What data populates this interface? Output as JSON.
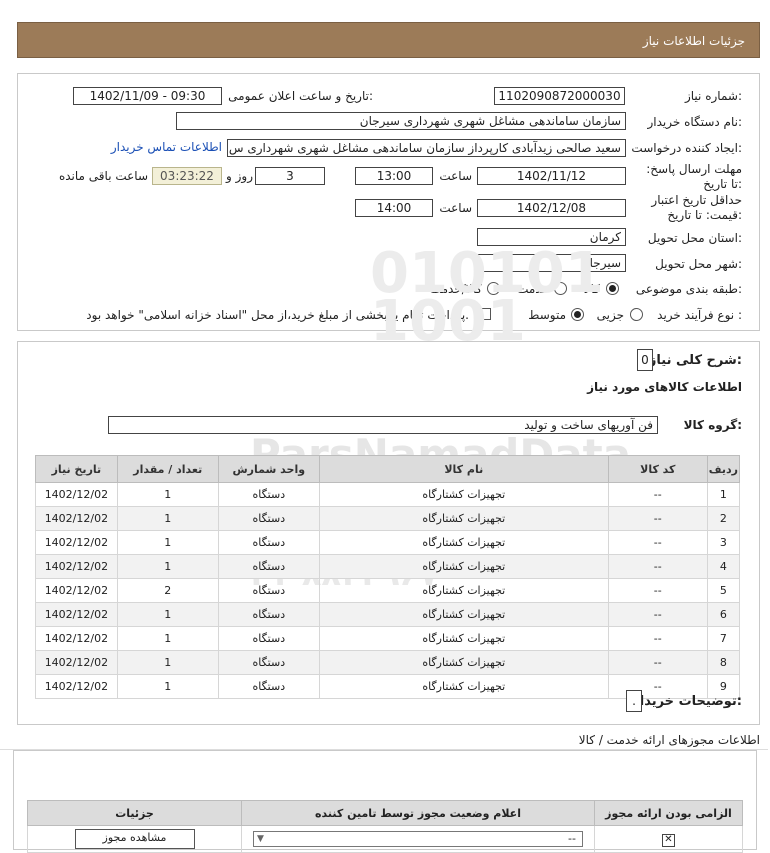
{
  "header": {
    "title": "جزئیات اطلاعات نیاز"
  },
  "form": {
    "need_number_label": "شماره نیاز:",
    "need_number": "1102090872000030",
    "announce_label": "تاریخ و ساعت اعلان عمومی:",
    "announce_value": "1402/11/09 - 09:30",
    "buyer_org_label": "نام دستگاه خریدار:",
    "buyer_org": "سازمان ساماندهی مشاغل شهری شهرداری سیرجان",
    "creator_label": "ایجاد کننده درخواست:",
    "creator": "سعید صالحی زیدآبادی کارپرداز سازمان ساماندهی مشاغل شهری شهرداری س",
    "contact_link": "اطلاعات تماس خریدار",
    "deadline_label": "مهلت ارسال پاسخ: تا تاریخ:",
    "deadline_date": "1402/11/12",
    "time_label": "ساعت",
    "deadline_time": "13:00",
    "days": "3",
    "days_label": "روز و",
    "remaining": "03:23:22",
    "remaining_label": "ساعت باقی مانده",
    "validity_label": "حداقل تاریخ اعتبار قیمت: تا تاریخ:",
    "validity_date": "1402/12/08",
    "validity_time": "14:00",
    "province_label": "استان محل تحویل:",
    "province": "کرمان",
    "city_label": "شهر محل تحویل:",
    "city": "سیرجان",
    "category_label": "طبقه بندی موضوعی:",
    "category_options": [
      "کالا",
      "خدمت",
      "کالا/خدمت"
    ],
    "category_selected": "کالا",
    "process_label": "نوع فرآیند خرید :",
    "process_options": [
      "جزیی",
      "متوسط"
    ],
    "process_selected": "متوسط",
    "payment_text": "پرداخت تمام یا بخشی از مبلغ خرید،از محل \"اسناد خزانه اسلامی\" خواهد بود."
  },
  "description": {
    "summary_label": "شرح کلی نیاز:",
    "summary_value": "0",
    "goods_title": "اطلاعات کالاهای مورد نیاز",
    "group_label": "گروه کالا:",
    "group_value": "فن آوریهای ساخت و تولید"
  },
  "items_table": {
    "headers": [
      "ردیف",
      "کد کالا",
      "نام کالا",
      "واحد شمارش",
      "تعداد / مقدار",
      "تاریخ نیاز"
    ],
    "rows": [
      [
        "1",
        "--",
        "تجهیزات کشتارگاه",
        "دستگاه",
        "1",
        "1402/12/02"
      ],
      [
        "2",
        "--",
        "تجهیزات کشتارگاه",
        "دستگاه",
        "1",
        "1402/12/02"
      ],
      [
        "3",
        "--",
        "تجهیزات کشتارگاه",
        "دستگاه",
        "1",
        "1402/12/02"
      ],
      [
        "4",
        "--",
        "تجهیزات کشتارگاه",
        "دستگاه",
        "1",
        "1402/12/02"
      ],
      [
        "5",
        "--",
        "تجهیزات کشتارگاه",
        "دستگاه",
        "2",
        "1402/12/02"
      ],
      [
        "6",
        "--",
        "تجهیزات کشتارگاه",
        "دستگاه",
        "1",
        "1402/12/02"
      ],
      [
        "7",
        "--",
        "تجهیزات کشتارگاه",
        "دستگاه",
        "1",
        "1402/12/02"
      ],
      [
        "8",
        "--",
        "تجهیزات کشتارگاه",
        "دستگاه",
        "1",
        "1402/12/02"
      ],
      [
        "9",
        "--",
        "تجهیزات کشتارگاه",
        "دستگاه",
        "1",
        "1402/12/02"
      ]
    ]
  },
  "buyer_notes": {
    "label": "توضیحات خریدار:",
    "value": "."
  },
  "licenses": {
    "title": "اطلاعات مجوزهای ارائه خدمت / کالا",
    "headers": [
      "الزامی بودن ارائه مجوز",
      "اعلام وضعیت مجوز توسط تامین کننده",
      "جزئیات"
    ],
    "select_value": "--",
    "view_button": "مشاهده مجوز"
  },
  "watermark": {
    "brand": "ParsNamadData",
    "phone": "۰۲۱-۸۸۳۴۹۶۷۰"
  },
  "colors": {
    "header_bg": "#9c7b58",
    "table_header": "#dcdcdc",
    "link": "#1a4fb5"
  }
}
